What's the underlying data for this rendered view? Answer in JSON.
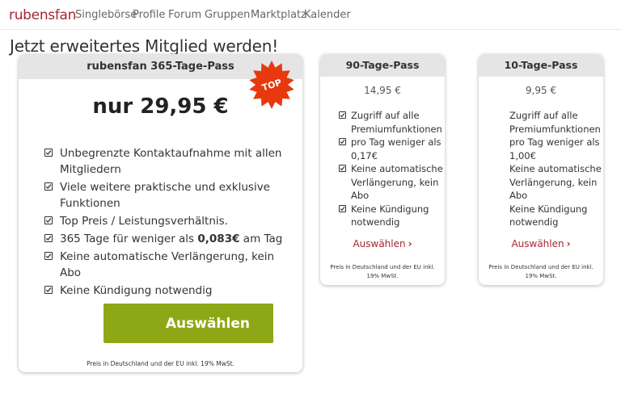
{
  "brand": {
    "logo": "rubensfan",
    "accent_color": "#a8262f"
  },
  "nav": {
    "items": [
      "Singlebörse",
      "Profile",
      "Forum",
      "Gruppen",
      "Marktplatz",
      "Kalender"
    ]
  },
  "page": {
    "title": "Jetzt erweitertes Mitglied werden!"
  },
  "main_plan": {
    "title": "rubensfan 365-Tage-Pass",
    "badge": "TOP",
    "badge_color": "#e8380d",
    "price": "nur 29,95 €",
    "features": [
      "Unbegrenzte Kontaktaufnahme mit allen Mitgliedern",
      "Viele weitere praktische und exklusive Funktionen",
      "Top Preis / Leistungsverhältnis.",
      {
        "before": "365 Tage für weniger als ",
        "bold": "0,083€",
        "after": " am Tag"
      },
      "Keine automatische Verlängerung, kein Abo",
      "Keine Kündigung notwendig"
    ],
    "button_label": "Auswählen",
    "button_color": "#8ea716",
    "note": "Preis in Deutschland und der EU inkl. 19% MwSt."
  },
  "plans": [
    {
      "title": "90-Tage-Pass",
      "price": "14,95 €",
      "features": [
        "Zugriff auf alle Premiumfunktionen",
        "pro Tag weniger als 0,17€",
        "Keine automatische Verlängerung, kein Abo",
        "Keine Kündigung notwendig"
      ],
      "checkboxes": true,
      "link_label": "Auswählen",
      "note_line1": "Preis in Deutschland und der EU inkl.",
      "note_line2": "19% MwSt."
    },
    {
      "title": "10-Tage-Pass",
      "price": "9,95 €",
      "features": [
        "Zugriff auf alle Premiumfunktionen",
        "pro Tag weniger als 1,00€",
        "Keine automatische Verlängerung, kein Abo",
        "Keine Kündigung notwendig"
      ],
      "checkboxes": false,
      "link_label": "Auswählen",
      "note_line1": "Preis in Deutschland und der EU inkl.",
      "note_line2": "19% MwSt."
    }
  ]
}
